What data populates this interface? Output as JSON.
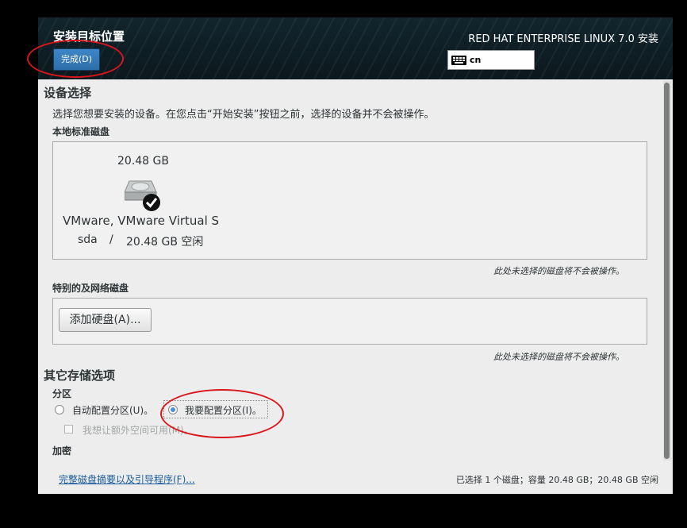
{
  "header": {
    "title": "安装目标位置",
    "done_button": "完成(D)",
    "product": "RED HAT ENTERPRISE LINUX 7.0 安装",
    "keyboard_icon": "keyboard-icon",
    "keyboard_layout": "cn"
  },
  "device_selection": {
    "title": "设备选择",
    "description": "选择您想要安装的设备。在您点击“开始安装”按钮之前，选择的设备并不会被操作。",
    "local_disks_title": "本地标准磁盘",
    "disk": {
      "size": "20.48 GB",
      "icon": "hard-disk-selected-icon",
      "name": "VMware, VMware Virtual S",
      "device": "sda",
      "separator": "/",
      "free": "20.48 GB 空闲"
    },
    "unselected_note": "此处未选择的磁盘将不会被操作。",
    "special_disks_title": "特别的及网络磁盘",
    "add_disk_button": "添加硬盘(A)...",
    "unselected_note_2": "此处未选择的磁盘将不会被操作。"
  },
  "storage_options": {
    "title": "其它存储选项",
    "partitioning_title": "分区",
    "auto_partition": "自动配置分区(U)。",
    "manual_partition": "我要配置分区(I)。",
    "selected_partitioning": "manual",
    "extra_space": "我想让额外空间可用(M)。",
    "encryption_title": "加密"
  },
  "footer": {
    "summary_link": "完整磁盘摘要以及引导程序(F)...",
    "status": "已选择 1 个磁盘；容量 20.48 GB；20.48 GB 空闲"
  },
  "colors": {
    "accent": "#2b6ea8",
    "annotation": "#d9151c",
    "link": "#1c5b9c"
  }
}
